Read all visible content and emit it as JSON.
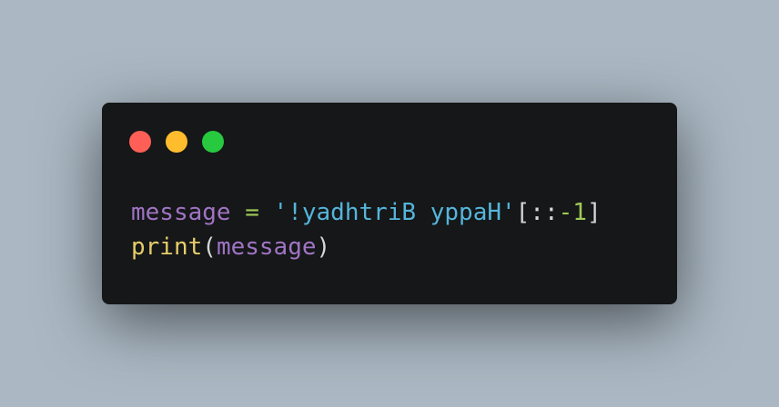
{
  "window": {
    "controls": [
      "close",
      "minimize",
      "maximize"
    ]
  },
  "code": {
    "language": "python",
    "lines": [
      [
        {
          "text": "message",
          "type": "var"
        },
        {
          "text": " ",
          "type": "space"
        },
        {
          "text": "=",
          "type": "op"
        },
        {
          "text": " ",
          "type": "space"
        },
        {
          "text": "'!yadhtriB yppaH'",
          "type": "str"
        },
        {
          "text": "[::",
          "type": "punc"
        },
        {
          "text": "-1",
          "type": "num"
        },
        {
          "text": "]",
          "type": "punc"
        }
      ],
      [
        {
          "text": "print",
          "type": "fn"
        },
        {
          "text": "(",
          "type": "punc"
        },
        {
          "text": "message",
          "type": "var"
        },
        {
          "text": ")",
          "type": "punc"
        }
      ]
    ]
  },
  "colors": {
    "background": "#abb8c3",
    "window": "#151718",
    "close": "#ff5f56",
    "minimize": "#ffbd2e",
    "maximize": "#27c93f",
    "variable": "#a074c4",
    "operator": "#9fca56",
    "string": "#55b5db",
    "punctuation": "#d4d7d6",
    "number": "#9fca56",
    "function": "#e6cd69"
  }
}
